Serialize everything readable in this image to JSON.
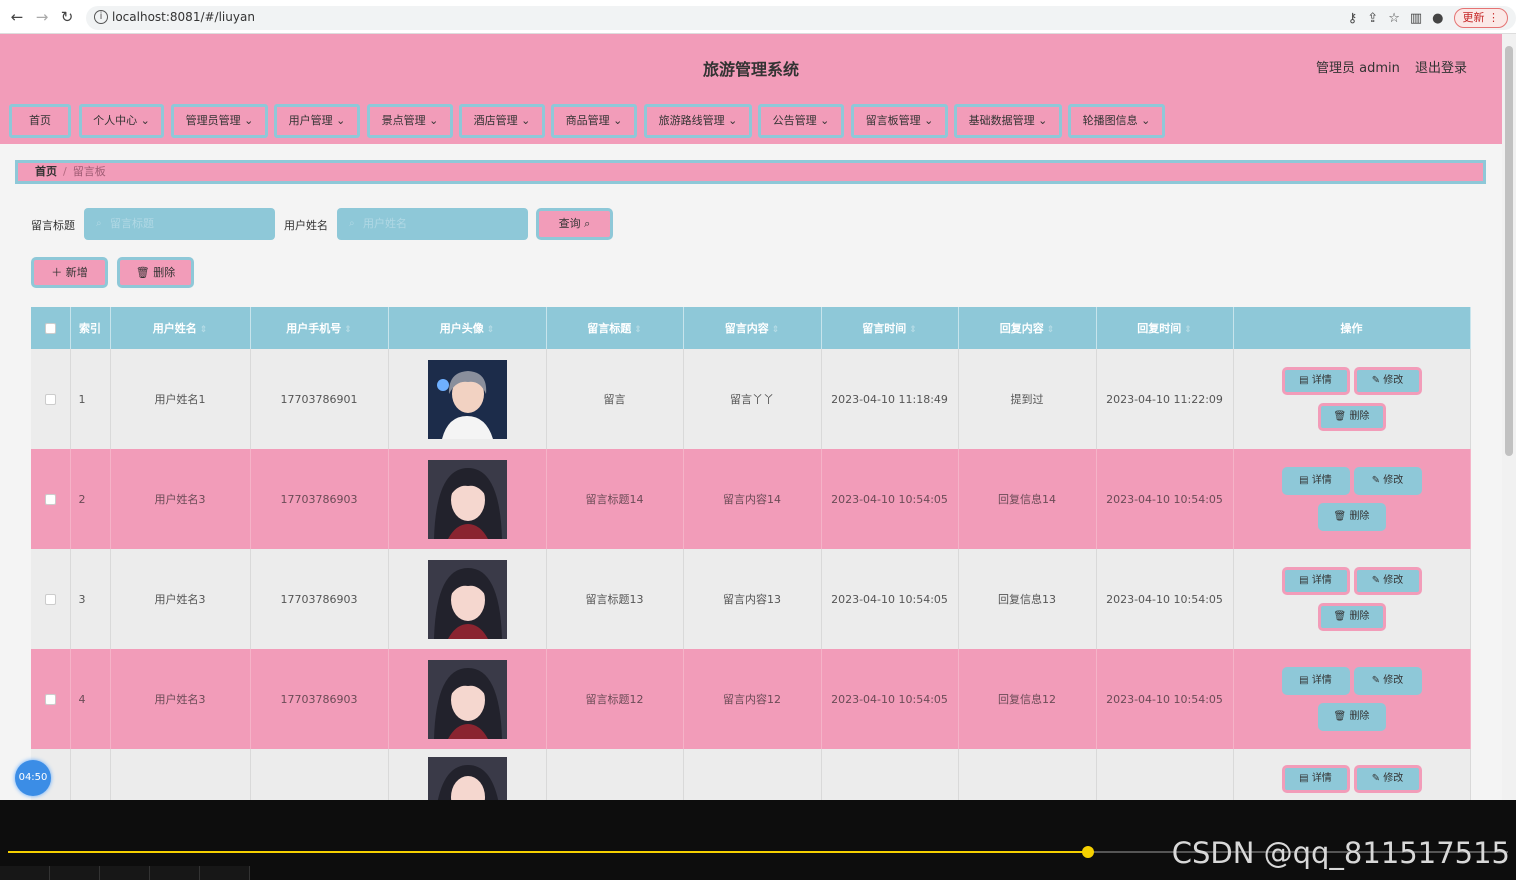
{
  "browser": {
    "url": "localhost:8081/#/liuyan",
    "update_label": "更新"
  },
  "header": {
    "title": "旅游管理系统",
    "admin_label": "管理员 admin",
    "logout_label": "退出登录"
  },
  "menu": [
    {
      "label": "首页"
    },
    {
      "label": "个人中心"
    },
    {
      "label": "管理员管理"
    },
    {
      "label": "用户管理"
    },
    {
      "label": "景点管理"
    },
    {
      "label": "酒店管理"
    },
    {
      "label": "商品管理"
    },
    {
      "label": "旅游路线管理"
    },
    {
      "label": "公告管理"
    },
    {
      "label": "留言板管理"
    },
    {
      "label": "基础数据管理"
    },
    {
      "label": "轮播图信息"
    }
  ],
  "breadcrumb": {
    "home": "首页",
    "current": "留言板"
  },
  "search": {
    "title_label": "留言标题",
    "title_placeholder": "留言标题",
    "user_label": "用户姓名",
    "user_placeholder": "用户姓名",
    "query_label": "查询"
  },
  "toolbar": {
    "add_label": "新增",
    "delete_label": "删除"
  },
  "table": {
    "headers": {
      "index": "索引",
      "user_name": "用户姓名",
      "phone": "用户手机号",
      "avatar": "用户头像",
      "title": "留言标题",
      "content": "留言内容",
      "time": "留言时间",
      "reply": "回复内容",
      "reply_time": "回复时间",
      "actions": "操作"
    },
    "actions": {
      "detail": "详情",
      "edit": "修改",
      "delete": "删除"
    },
    "rows": [
      {
        "index": "1",
        "user_name": "用户姓名1",
        "phone": "17703786901",
        "title": "留言",
        "content": "留言丫丫",
        "time": "2023-04-10 11:18:49",
        "reply": "提到过",
        "reply_time": "2023-04-10 11:22:09"
      },
      {
        "index": "2",
        "user_name": "用户姓名3",
        "phone": "17703786903",
        "title": "留言标题14",
        "content": "留言内容14",
        "time": "2023-04-10 10:54:05",
        "reply": "回复信息14",
        "reply_time": "2023-04-10 10:54:05"
      },
      {
        "index": "3",
        "user_name": "用户姓名3",
        "phone": "17703786903",
        "title": "留言标题13",
        "content": "留言内容13",
        "time": "2023-04-10 10:54:05",
        "reply": "回复信息13",
        "reply_time": "2023-04-10 10:54:05"
      },
      {
        "index": "4",
        "user_name": "用户姓名3",
        "phone": "17703786903",
        "title": "留言标题12",
        "content": "留言内容12",
        "time": "2023-04-10 10:54:05",
        "reply": "回复信息12",
        "reply_time": "2023-04-10 10:54:05"
      }
    ]
  },
  "video": {
    "timer": "04:50",
    "watermark": "CSDN @qq_811517515",
    "progress": 0.72
  }
}
